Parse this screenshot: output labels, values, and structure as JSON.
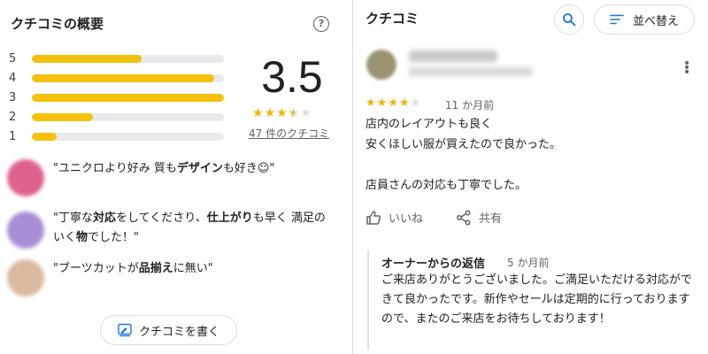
{
  "summary": {
    "title": "クチコミの概要",
    "help_icon": "question-mark-icon",
    "score": "3.5",
    "rating_value": 3.5,
    "review_count_link": "47 件のクチコミ",
    "distribution": [
      {
        "label": "5",
        "fraction": 0.57
      },
      {
        "label": "4",
        "fraction": 0.95
      },
      {
        "label": "3",
        "fraction": 1.0
      },
      {
        "label": "2",
        "fraction": 0.32
      },
      {
        "label": "1",
        "fraction": 0.13
      }
    ],
    "snippets": [
      {
        "avatar_color": "#e0608f",
        "parts": [
          [
            "\"ユニクロより好み 質も",
            false
          ],
          [
            "デザイン",
            true
          ],
          [
            "も好き☺\"",
            false
          ]
        ]
      },
      {
        "avatar_color": "#a98ed6",
        "parts": [
          [
            "\"丁寧な",
            false
          ],
          [
            "対応",
            true
          ],
          [
            "をしてくださり、",
            false
          ],
          [
            "仕上がり",
            true
          ],
          [
            "も早く 満足のいく",
            false
          ],
          [
            "物",
            true
          ],
          [
            "でした！\"",
            false
          ]
        ]
      },
      {
        "avatar_color": "#d9b9a0",
        "parts": [
          [
            "\"ブーツカットが",
            false
          ],
          [
            "品揃え",
            true
          ],
          [
            "に無い\"",
            false
          ]
        ]
      }
    ],
    "write_button": "クチコミを書く"
  },
  "reviews": {
    "title": "クチコミ",
    "search_icon": "search-icon",
    "sort_button": "並べ替え",
    "item": {
      "rating": 4,
      "time": "11 か月前",
      "text": "店内のレイアウトも良く\n安くほしい服が買えたので良かった。\n\n店員さんの対応も丁寧でした。",
      "like_label": "いいね",
      "share_label": "共有",
      "owner_reply": {
        "title": "オーナーからの返信",
        "time": "5 か月前",
        "text": "ご来店ありがとうございました。ご満足いただける対応ができて良かったです。新作やセールは定期的に行っておりますので、またのご来店をお待ちしております！"
      }
    }
  },
  "colors": {
    "star": "#f4b400",
    "bar": "#f4c20d",
    "track": "#e8eaed"
  }
}
